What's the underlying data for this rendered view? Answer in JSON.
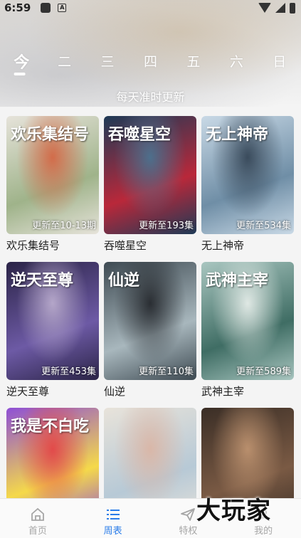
{
  "status": {
    "time": "6:59",
    "notif_letter": "A"
  },
  "days": [
    "今",
    "二",
    "三",
    "四",
    "五",
    "六",
    "日"
  ],
  "active_day_index": 0,
  "subtitle": "每天准时更新",
  "shows": [
    {
      "title": "欢乐集结号",
      "episode": "更新至10-13期",
      "poster_text": "欢乐集结号",
      "colors": [
        "#e6e3da",
        "#9fb38a",
        "#d26c4a"
      ]
    },
    {
      "title": "吞噬星空",
      "episode": "更新至193集",
      "poster_text": "吞噬星空",
      "colors": [
        "#1e3a56",
        "#b9283a",
        "#4d6f8c"
      ]
    },
    {
      "title": "无上神帝",
      "episode": "更新至534集",
      "poster_text": "无上神帝",
      "colors": [
        "#c9d9e6",
        "#6f8ea6",
        "#3a4b5c"
      ]
    },
    {
      "title": "逆天至尊",
      "episode": "更新至453集",
      "poster_text": "逆天至尊",
      "colors": [
        "#2b2447",
        "#6d5aa5",
        "#b4a6c9"
      ]
    },
    {
      "title": "仙逆",
      "episode": "更新至110集",
      "poster_text": "仙逆",
      "colors": [
        "#3e4a52",
        "#a8b7bd",
        "#2a2e33"
      ]
    },
    {
      "title": "武神主宰",
      "episode": "更新至589集",
      "poster_text": "武神主宰",
      "colors": [
        "#a9c6c0",
        "#3f6d64",
        "#dfe8e4"
      ]
    },
    {
      "title": "",
      "episode": "",
      "poster_text": "我是不白吃",
      "colors": [
        "#8e4fd6",
        "#f5d94a",
        "#e24a4a"
      ]
    },
    {
      "title": "",
      "episode": "",
      "poster_text": "",
      "colors": [
        "#e8e3da",
        "#b7c9d6",
        "#d9b7a8"
      ]
    },
    {
      "title": "",
      "episode": "",
      "poster_text": "",
      "colors": [
        "#3a2e26",
        "#7a5a44",
        "#b98f6d"
      ]
    }
  ],
  "tabs": [
    {
      "label": "首页",
      "icon": "home-icon"
    },
    {
      "label": "周表",
      "icon": "list-icon"
    },
    {
      "label": "特权",
      "icon": "send-icon"
    },
    {
      "label": "我的",
      "icon": "user-icon"
    }
  ],
  "active_tab_index": 1,
  "watermark": "大玩家"
}
